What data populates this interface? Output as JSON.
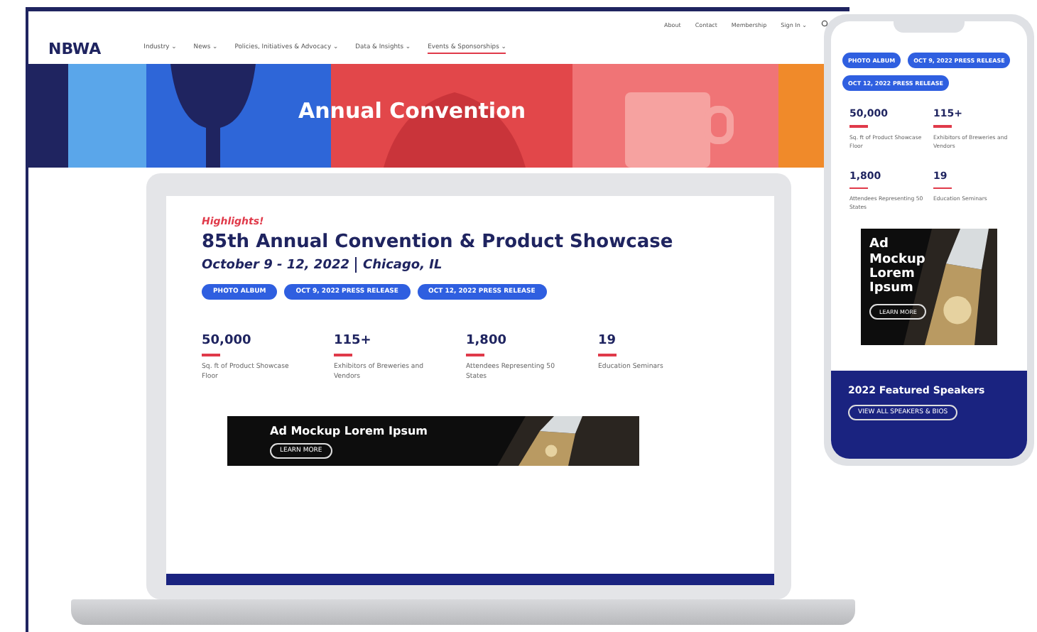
{
  "site": {
    "logo": "NBWA",
    "utility_links": [
      "About",
      "Contact",
      "Membership",
      "Sign In ⌄"
    ],
    "nav": [
      {
        "label": "Industry ⌄",
        "selected": false
      },
      {
        "label": "News ⌄",
        "selected": false
      },
      {
        "label": "Policies, Initiatives & Advocacy ⌄",
        "selected": false
      },
      {
        "label": "Data & Insights ⌄",
        "selected": false
      },
      {
        "label": "Events & Sponsorships ⌄",
        "selected": true
      }
    ],
    "hero_title": "Annual Convention"
  },
  "laptop": {
    "eyebrow": "Highlights!",
    "title": "85th Annual Convention & Product Showcase",
    "date": "October 9 - 12, 2022",
    "location": "Chicago, IL",
    "buttons": [
      "PHOTO ALBUM",
      "OCT 9, 2022 PRESS RELEASE",
      "OCT 12, 2022 PRESS RELEASE"
    ],
    "stats": [
      {
        "value": "50,000",
        "label": "Sq. ft of Product Showcase Floor"
      },
      {
        "value": "115+",
        "label": "Exhibitors of Breweries and Vendors"
      },
      {
        "value": "1,800",
        "label": "Attendees Representing 50 States"
      },
      {
        "value": "19",
        "label": "Education Seminars"
      }
    ],
    "ad": {
      "title": "Ad Mockup Lorem Ipsum",
      "button": "LEARN MORE"
    }
  },
  "phone": {
    "buttons": [
      "PHOTO ALBUM",
      "OCT 9, 2022 PRESS RELEASE",
      "OCT 12, 2022 PRESS RELEASE"
    ],
    "stats": [
      {
        "value": "50,000",
        "label": "Sq. ft of Product Showcase Floor"
      },
      {
        "value": "115+",
        "label": "Exhibitors of Breweries and Vendors"
      },
      {
        "value": "1,800",
        "label": "Attendees Representing 50 States"
      },
      {
        "value": "19",
        "label": "Education Seminars"
      }
    ],
    "ad": {
      "title": "Ad Mockup Lorem Ipsum",
      "button": "LEARN MORE"
    },
    "speakers": {
      "title": "2022 Featured Speakers",
      "button": "VIEW ALL SPEAKERS & BIOS"
    }
  }
}
